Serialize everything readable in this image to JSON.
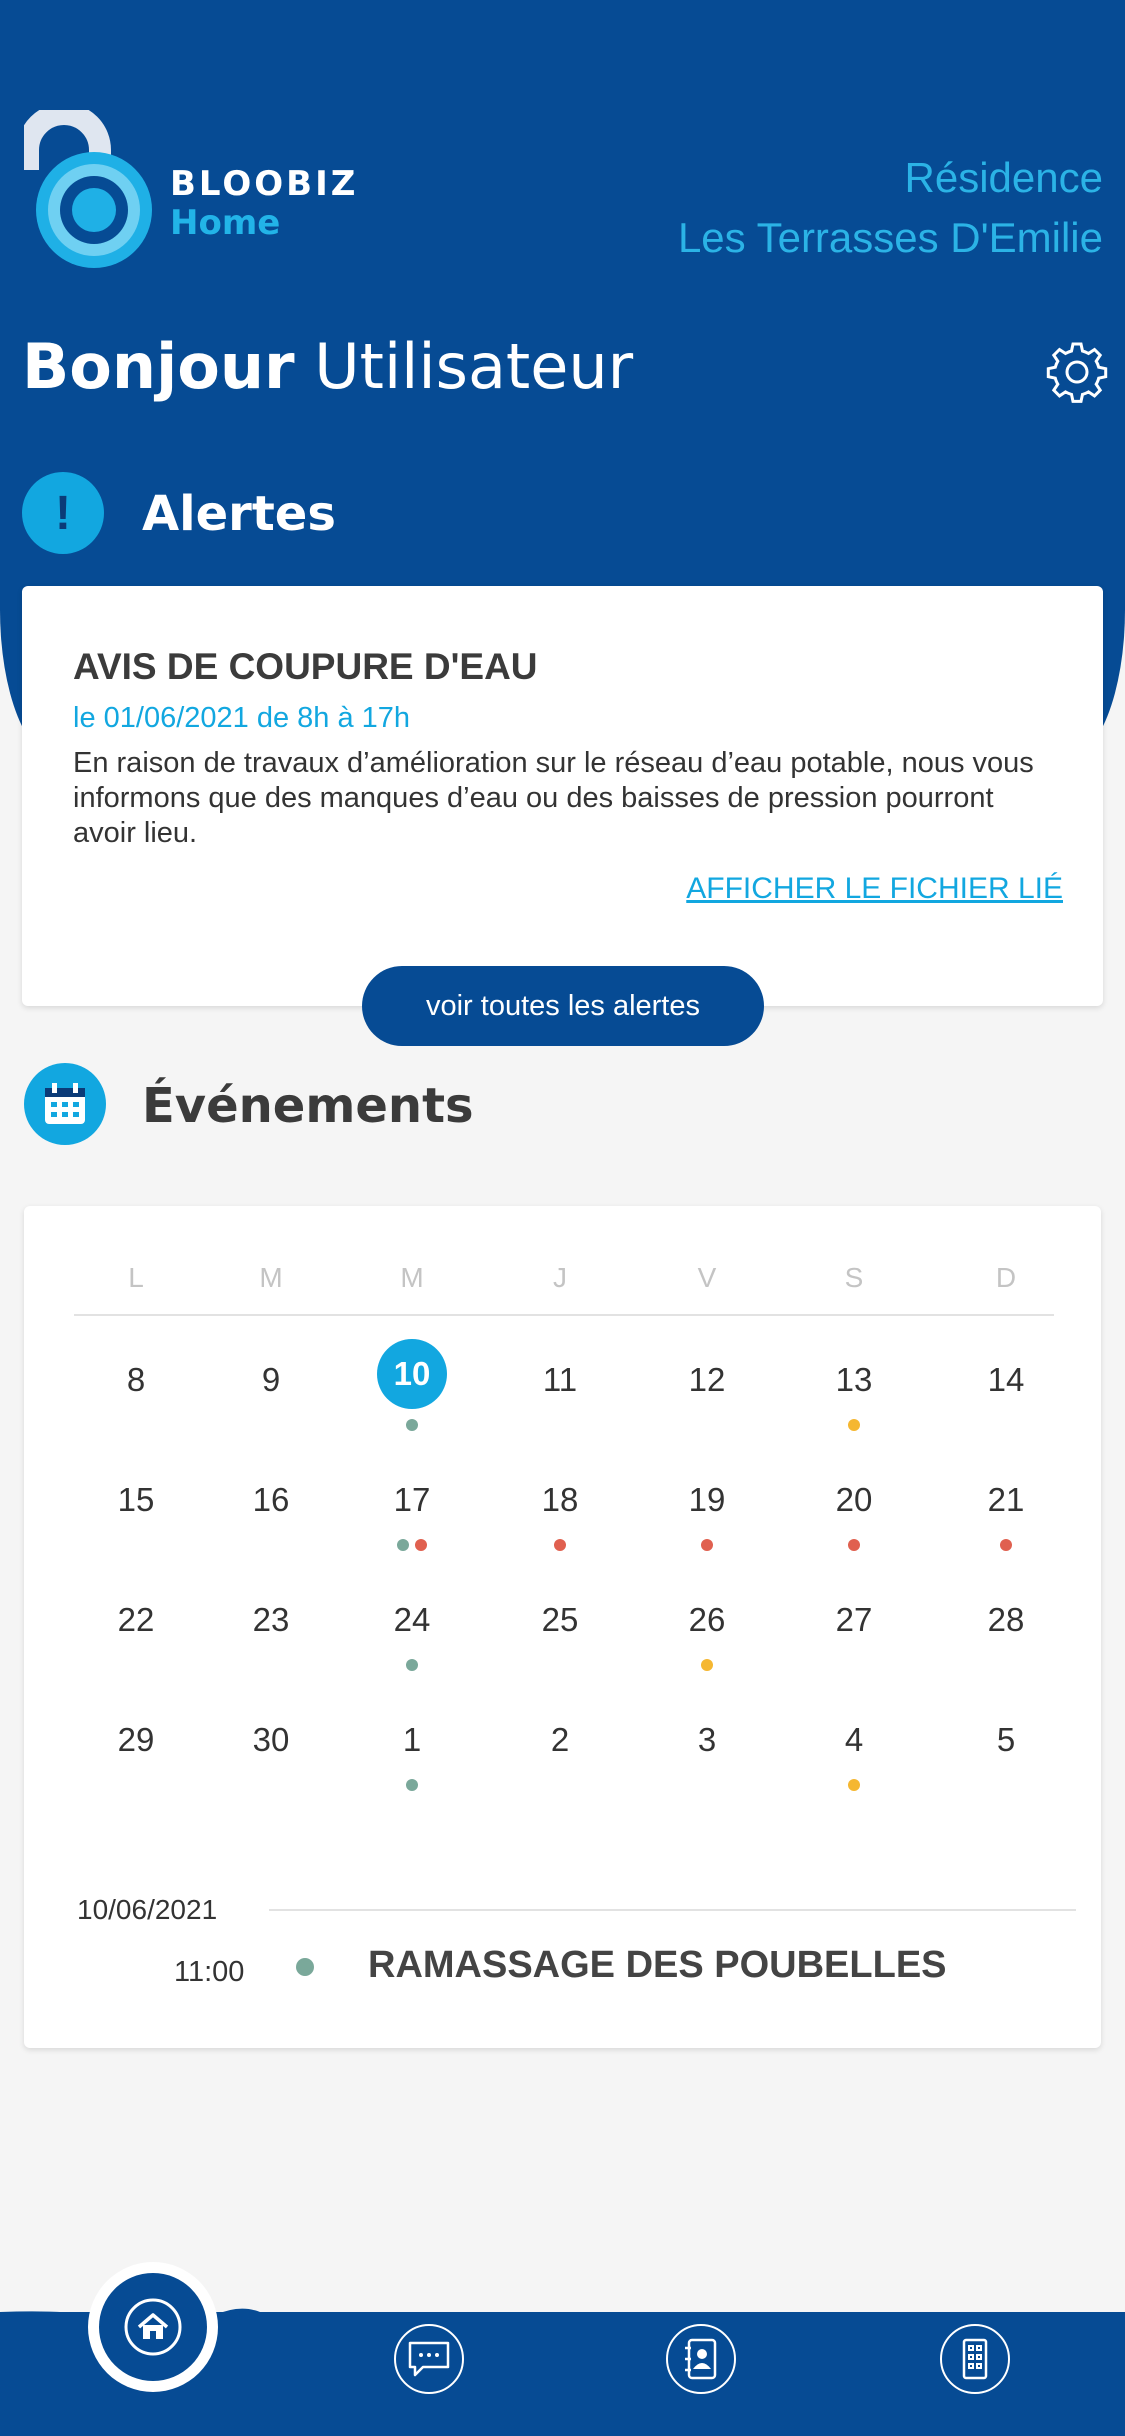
{
  "header": {
    "brand_line1": "BLOOBIZ",
    "brand_line2": "Home",
    "residence_line1": "Résidence",
    "residence_line2": "Les Terrasses D'Emilie",
    "greeting_bold": "Bonjour",
    "greeting_name": " Utilisateur"
  },
  "alerts": {
    "section_title": "Alertes",
    "icon_glyph": "!",
    "card": {
      "title": "AVIS DE COUPURE D'EAU",
      "date": "le 01/06/2021 de 8h à 17h",
      "body": "En raison de travaux d’amélioration sur le réseau d’eau potable, nous vous informons que des manques d’eau ou des baisses de pression pourront avoir lieu.",
      "link": "AFFICHER LE FICHIER LIÉ"
    },
    "see_all_label": "voir toutes les alertes"
  },
  "events": {
    "section_title": "Événements",
    "weekdays": [
      "L",
      "M",
      "M",
      "J",
      "V",
      "S",
      "D"
    ],
    "weeks": [
      [
        "8",
        "9",
        "10",
        "11",
        "12",
        "13",
        "14"
      ],
      [
        "15",
        "16",
        "17",
        "18",
        "19",
        "20",
        "21"
      ],
      [
        "22",
        "23",
        "24",
        "25",
        "26",
        "27",
        "28"
      ],
      [
        "29",
        "30",
        "1",
        "2",
        "3",
        "4",
        "5"
      ]
    ],
    "selected_day": "10",
    "event_dots": {
      "0-2": [
        "green"
      ],
      "0-5": [
        "yellow"
      ],
      "1-2": [
        "green",
        "red"
      ],
      "1-3": [
        "red"
      ],
      "1-4": [
        "red"
      ],
      "1-5": [
        "red"
      ],
      "1-6": [
        "red"
      ],
      "2-2": [
        "green"
      ],
      "2-4": [
        "yellow"
      ],
      "3-2": [
        "green"
      ],
      "3-5": [
        "yellow"
      ]
    },
    "selected_date": "10/06/2021",
    "list": [
      {
        "time": "11:00",
        "name": "RAMASSAGE DES POUBELLES",
        "color": "green"
      }
    ]
  },
  "colors": {
    "primary": "#064b94",
    "accent": "#12a7e0",
    "green": "#7aa89a",
    "red": "#e0604f",
    "yellow": "#f5b731"
  },
  "tabbar": {
    "items": [
      "home-icon",
      "chat-icon",
      "contacts-icon",
      "building-icon"
    ],
    "active": "home-icon"
  }
}
